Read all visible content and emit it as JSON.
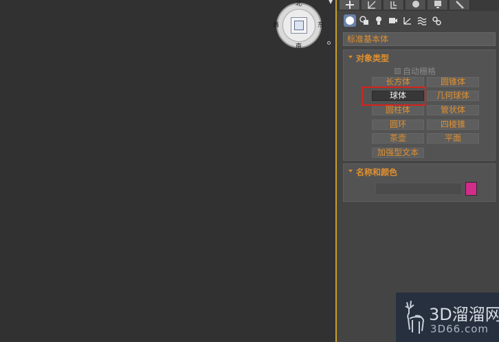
{
  "viewcube": {
    "north": "北",
    "south": "南",
    "west": "西",
    "east": "东"
  },
  "command_panel": {
    "tabs": [
      {
        "icon": "create-plus-icon"
      },
      {
        "icon": "modify-icon"
      },
      {
        "icon": "hierarchy-icon"
      },
      {
        "icon": "motion-icon"
      },
      {
        "icon": "display-icon"
      },
      {
        "icon": "utilities-wrench-icon"
      }
    ],
    "categories": [
      {
        "icon": "geometry-sphere-icon"
      },
      {
        "icon": "shapes-icon"
      },
      {
        "icon": "lights-icon"
      },
      {
        "icon": "cameras-icon"
      },
      {
        "icon": "helpers-icon"
      },
      {
        "icon": "space-warps-icon"
      },
      {
        "icon": "systems-icon"
      }
    ],
    "dropdown_value": "标准基本体",
    "object_type": {
      "title": "对象类型",
      "autogrid_label": "自动栅格",
      "buttons": {
        "box": "长方体",
        "cone": "圆锥体",
        "sphere": "球体",
        "geosphere": "几何球体",
        "cylinder": "圆柱体",
        "tube": "管状体",
        "torus": "圆环",
        "pyramid": "四棱锥",
        "teapot": "茶壶",
        "plane": "平面",
        "text_plus": "加强型文本"
      },
      "selected": "球体"
    },
    "name_and_color": {
      "title": "名称和颜色",
      "name_value": "",
      "color": "#d22d8a"
    }
  },
  "watermark": {
    "main": "3D溜溜网",
    "sub": "3D66.com"
  },
  "colors": {
    "accent_orange": "#e0902e",
    "highlight_red": "#d8221d",
    "viewport_border": "#c9a227"
  }
}
